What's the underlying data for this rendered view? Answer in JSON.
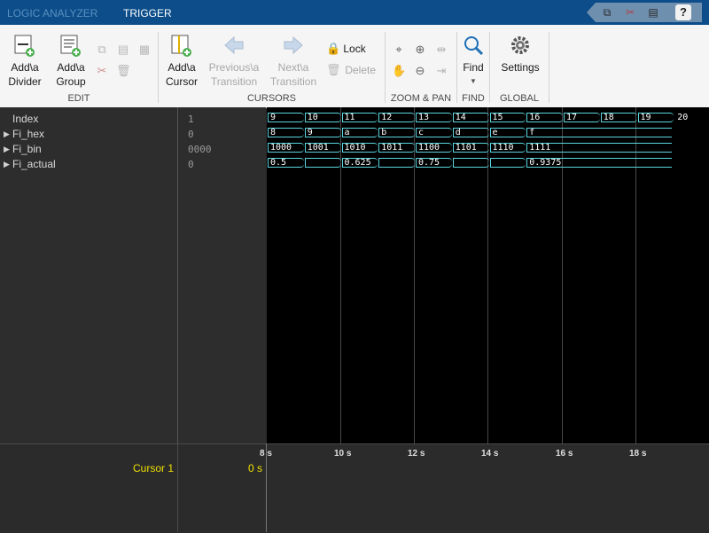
{
  "tabs": [
    {
      "label": "LOGIC ANALYZER",
      "active": false
    },
    {
      "label": "TRIGGER",
      "active": true
    }
  ],
  "quick_access": [
    "copy-icon",
    "cut-icon",
    "paste-icon",
    "help-icon"
  ],
  "help_label": "?",
  "toolstrip": {
    "sections": [
      {
        "label": "EDIT",
        "buttons": [
          {
            "label": "Add\\a\nDivider",
            "icon": "add-divider-icon",
            "enabled": true
          },
          {
            "label": "Add\\a\nGroup",
            "icon": "add-group-icon",
            "enabled": true
          }
        ],
        "small": [
          "copy-icon",
          "paste-icon",
          "paste-special-icon",
          "cut-icon",
          "delete-icon"
        ]
      },
      {
        "label": "CURSORS",
        "buttons": [
          {
            "label": "Add\\a\nCursor",
            "icon": "add-cursor-icon",
            "enabled": true
          },
          {
            "label": "Previous\\a\nTransition",
            "icon": "arrow-left-icon",
            "enabled": false
          },
          {
            "label": "Next\\a\nTransition",
            "icon": "arrow-right-icon",
            "enabled": false
          },
          {
            "label": "Lock",
            "icon": "lock-icon",
            "enabled": true
          },
          {
            "label": "Delete",
            "icon": "delete-icon",
            "enabled": false
          }
        ]
      },
      {
        "label": "ZOOM & PAN",
        "small": [
          "zoom-cursor-icon",
          "zoom-in-icon",
          "fit-icon",
          "pan-icon",
          "zoom-out-icon",
          "fit-to-cursor-icon"
        ]
      },
      {
        "label": "FIND",
        "buttons": [
          {
            "label": "Find",
            "icon": "find-icon",
            "enabled": true
          }
        ]
      },
      {
        "label": "GLOBAL",
        "buttons": [
          {
            "label": "Settings",
            "icon": "gear-icon",
            "enabled": true
          }
        ]
      }
    ]
  },
  "signals": [
    {
      "name": "Index",
      "value": "1",
      "expandable": false
    },
    {
      "name": "Fi_hex",
      "value": "0",
      "expandable": true
    },
    {
      "name": "Fi_bin",
      "value": "0000",
      "expandable": true
    },
    {
      "name": "Fi_actual",
      "value": "0",
      "expandable": true
    }
  ],
  "waveforms": [
    {
      "signal": "Index",
      "samples": [
        "9",
        "10",
        "11",
        "12",
        "13",
        "14",
        "15",
        "16",
        "17",
        "18",
        "19",
        "20"
      ]
    },
    {
      "signal": "Fi_hex",
      "samples": [
        "8",
        "9",
        "a",
        "b",
        "c",
        "d",
        "e",
        "f"
      ]
    },
    {
      "signal": "Fi_bin",
      "samples": [
        "1000",
        "1001",
        "1010",
        "1011",
        "1100",
        "1101",
        "1110",
        "1111"
      ]
    },
    {
      "signal": "Fi_actual",
      "samples": [
        "0.5",
        "",
        "0.625",
        "",
        "0.75",
        "",
        "",
        "0.9375"
      ]
    }
  ],
  "time_axis": {
    "ticks": [
      "8 s",
      "10 s",
      "12 s",
      "14 s",
      "16 s",
      "18 s"
    ]
  },
  "cursor": {
    "name": "Cursor 1",
    "value": "0 s"
  },
  "colors": {
    "title_bar": "#0c4d8a",
    "waveform": "#5ad6e0",
    "cursor_text": "#f0e000",
    "wave_bg": "#000000"
  }
}
